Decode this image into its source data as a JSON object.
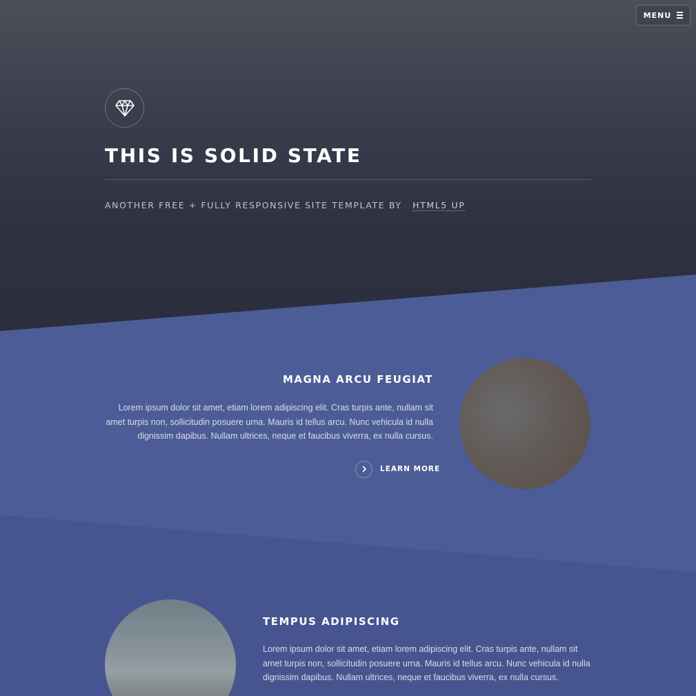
{
  "header": {
    "menu_label": "Menu",
    "menu_icon": "hamburger-icon"
  },
  "banner": {
    "logo_icon": "diamond-icon",
    "title": "This is Solid State",
    "subtitle": "Another free + fully responsive site template by",
    "link_text": "HTML5 UP"
  },
  "spotlights": [
    {
      "title": "Magna arcu feugiat",
      "text": "Lorem ipsum dolor sit amet, etiam lorem adipiscing elit. Cras turpis ante, nullam sit amet turpis non, sollicitudin posuere urna. Mauris id tellus arcu. Nunc vehicula id nulla dignissim dapibus. Nullam ultrices, neque et faucibus viverra, ex nulla cursus.",
      "button_label": "Learn more",
      "button_icon": "chevron-right-icon"
    },
    {
      "title": "Tempus adipiscing",
      "text": "Lorem ipsum dolor sit amet, etiam lorem adipiscing elit. Cras turpis ante, nullam sit amet turpis non, sollicitudin posuere urna. Mauris id tellus arcu. Nunc vehicula id nulla dignissim dapibus. Nullam ultrices, neque et faucibus viverra, ex nulla cursus."
    }
  ],
  "colors": {
    "header_bg": "#2e3141",
    "spotlight1_bg": "#4c5c96",
    "spotlight2_bg": "#465590"
  }
}
